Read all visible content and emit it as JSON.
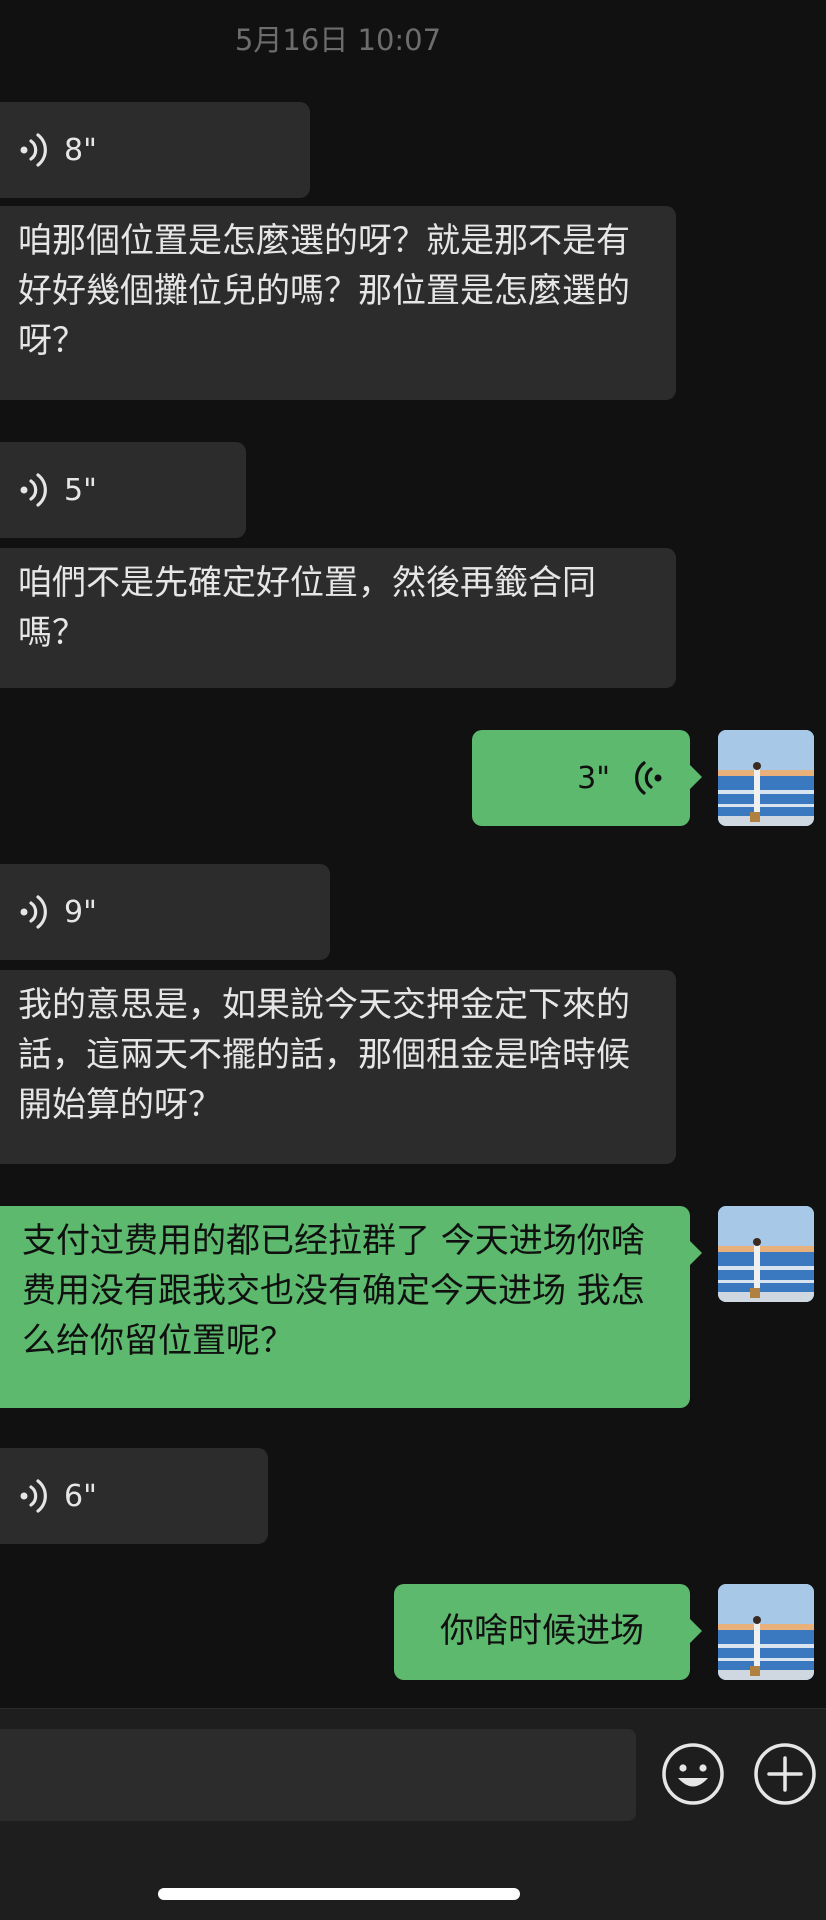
{
  "timestamp": "5月16日 10:07",
  "messages": [
    {
      "type": "voice",
      "duration": "8\""
    },
    {
      "type": "text",
      "text": "咱那個位置是怎麼選的呀？就是那不是有好好幾個攤位兒的嗎？那位置是怎麼選的呀？"
    },
    {
      "type": "voice",
      "duration": "5\""
    },
    {
      "type": "text",
      "text": "咱們不是先確定好位置，然後再籤合同嗎？"
    },
    {
      "type": "voice",
      "duration": "3\""
    },
    {
      "type": "voice",
      "duration": "9\""
    },
    {
      "type": "text",
      "text": "我的意思是，如果說今天交押金定下來的話，這兩天不擺的話，那個租金是啥時候開始算的呀？"
    },
    {
      "type": "text",
      "text": "支付过费用的都已经拉群了 今天进场你啥费用没有跟我交也没有确定今天进场 我怎么给你留位置呢？"
    },
    {
      "type": "voice",
      "duration": "6\""
    },
    {
      "type": "text",
      "text": "你啥时候进场"
    }
  ],
  "icons": {
    "voice_in": "voice-wave-icon",
    "voice_out": "voice-wave-icon",
    "emoji": "smiley-face-icon",
    "add": "plus-circle-icon"
  },
  "input": {
    "value": "",
    "placeholder": ""
  },
  "colors": {
    "background": "#111111",
    "incoming_bubble": "#2c2c2c",
    "outgoing_bubble": "#5cb96d",
    "timestamp": "#6d6d6d"
  }
}
